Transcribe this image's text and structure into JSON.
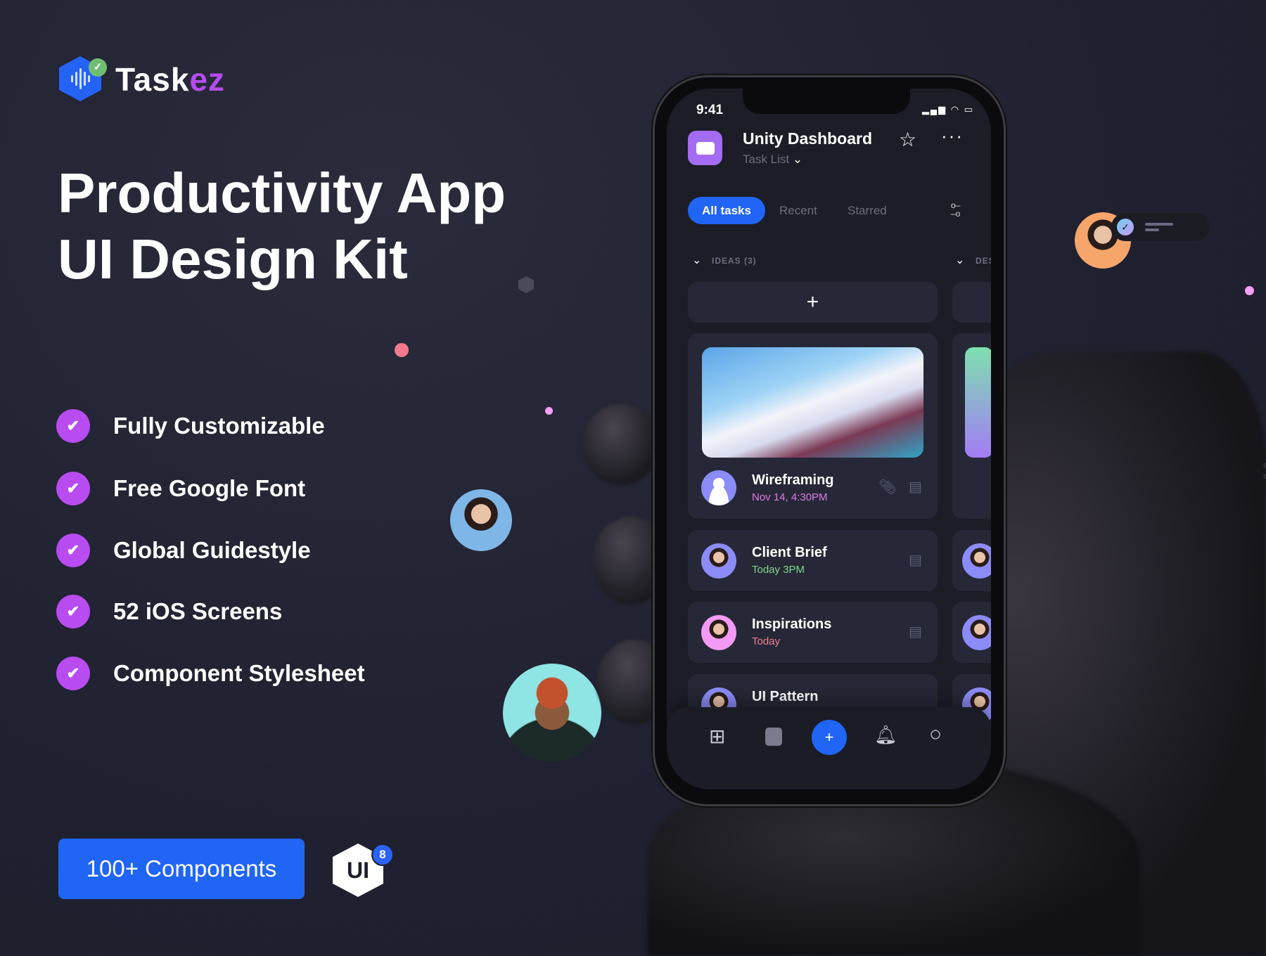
{
  "brand": {
    "name_main": "Task",
    "name_accent": "ez"
  },
  "headline": {
    "line1": "Productivity App",
    "line2": "UI Design Kit"
  },
  "features": [
    "Fully Customizable",
    "Free Google Font",
    "Global Guidestyle",
    "52 iOS Screens",
    "Component Stylesheet"
  ],
  "cta": {
    "label": "100+ Components"
  },
  "badge": {
    "label": "UI",
    "count": "8"
  },
  "colors": {
    "accent_blue": "#2065f5",
    "accent_purple": "#b84cf0",
    "background": "#212232"
  },
  "phone": {
    "status": {
      "time": "9:41"
    },
    "header": {
      "title": "Unity Dashboard",
      "subtitle": "Task List"
    },
    "tabs": [
      {
        "label": "All tasks",
        "active": true
      },
      {
        "label": "Recent"
      },
      {
        "label": "Starred"
      }
    ],
    "sections": [
      {
        "label": "IDEAS (3)"
      },
      {
        "label": "DES"
      }
    ],
    "add_label": "+",
    "tasks": [
      {
        "title": "Wireframing",
        "date": "Nov 14, 4:30PM",
        "date_color": "#e07be8",
        "has_attachment": true
      },
      {
        "title": "Client Brief",
        "date": "Today 3PM",
        "date_color": "#7fd88a"
      },
      {
        "title": "Inspirations",
        "date": "Today",
        "date_color": "#f07f8f"
      },
      {
        "title": "UI Pattern",
        "date": ""
      }
    ],
    "nav": [
      "grid-icon",
      "list-icon",
      "add-icon",
      "bell-icon",
      "search-icon"
    ]
  }
}
